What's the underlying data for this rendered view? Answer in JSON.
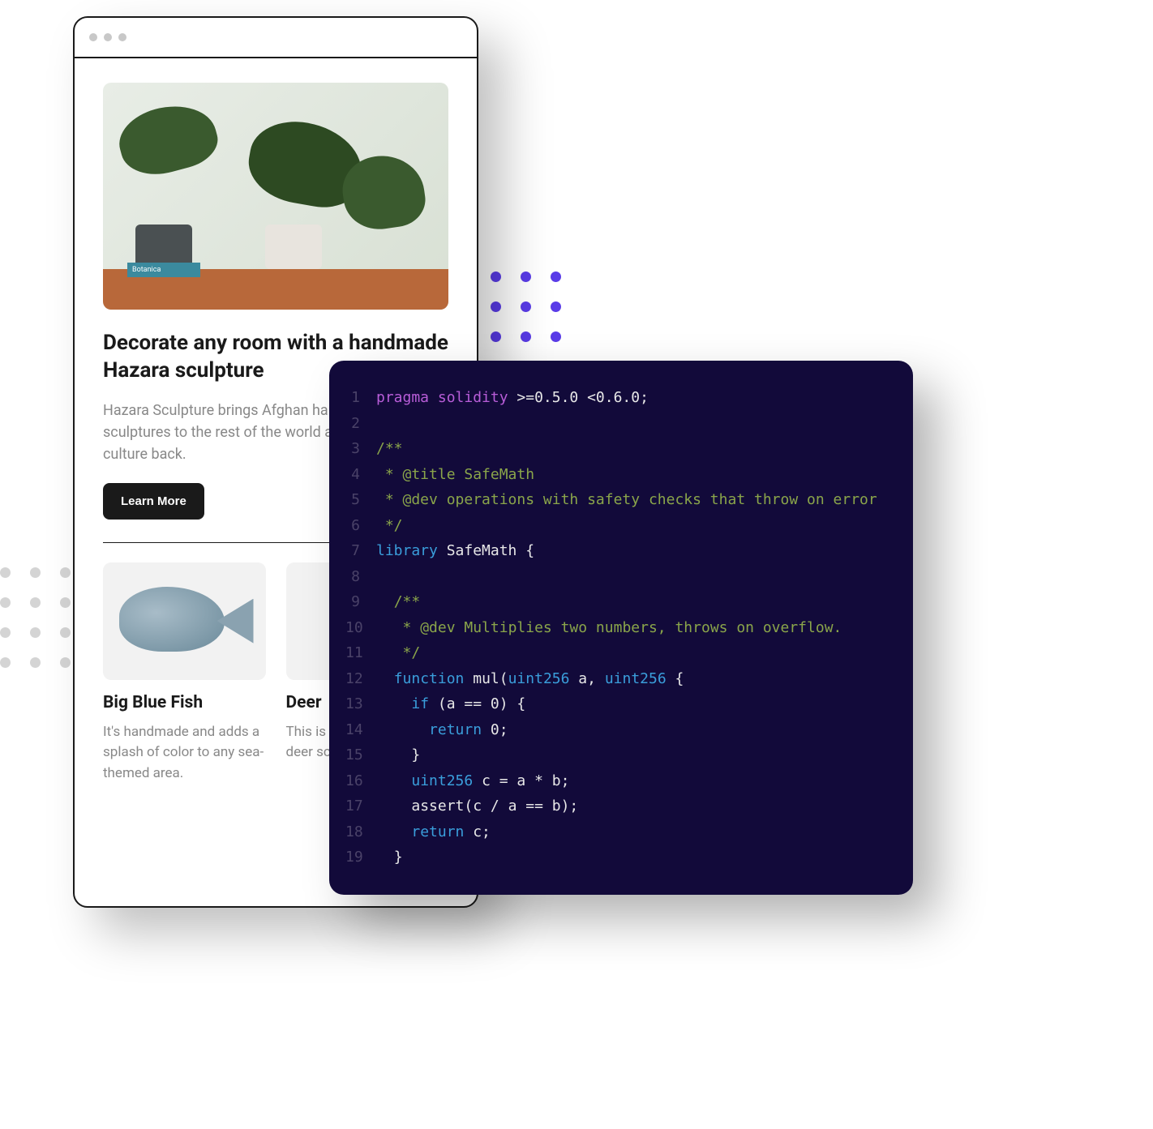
{
  "article": {
    "image_label": "Botanica",
    "title": "Decorate any room with a handmade Hazara sculpture",
    "description": "Hazara Sculpture brings Afghan handmade sculptures to the rest of the world and also keeps its culture back.",
    "button_label": "Learn More"
  },
  "products": [
    {
      "title": "Big Blue Fish",
      "description": "It's handmade and adds a splash of color to any sea-themed area."
    },
    {
      "title": "Deer",
      "description": "This is a handmade gold deer sculpture."
    }
  ],
  "code": {
    "lines": [
      {
        "n": 1,
        "segments": [
          {
            "t": "pragma solidity ",
            "c": "tok-kw"
          },
          {
            "t": ">=0.5.0 <0.6.0;",
            "c": "tok-ver"
          }
        ]
      },
      {
        "n": 2,
        "segments": []
      },
      {
        "n": 3,
        "segments": [
          {
            "t": "/**",
            "c": "tok-comment"
          }
        ]
      },
      {
        "n": 4,
        "segments": [
          {
            "t": " * @title SafeMath",
            "c": "tok-comment"
          }
        ]
      },
      {
        "n": 5,
        "segments": [
          {
            "t": " * @dev operations with safety checks that throw on error",
            "c": "tok-comment"
          }
        ]
      },
      {
        "n": 6,
        "segments": [
          {
            "t": " */",
            "c": "tok-comment"
          }
        ]
      },
      {
        "n": 7,
        "segments": [
          {
            "t": "library ",
            "c": "tok-lib"
          },
          {
            "t": "SafeMath {",
            "c": "tok-name"
          }
        ]
      },
      {
        "n": 8,
        "indent": 1,
        "segments": []
      },
      {
        "n": 9,
        "indent": 1,
        "segments": [
          {
            "t": "/**",
            "c": "tok-comment"
          }
        ]
      },
      {
        "n": 10,
        "indent": 1,
        "segments": [
          {
            "t": " * @dev Multiplies two numbers, throws on overflow.",
            "c": "tok-comment"
          }
        ]
      },
      {
        "n": 11,
        "indent": 1,
        "segments": [
          {
            "t": " */",
            "c": "tok-comment"
          }
        ]
      },
      {
        "n": 12,
        "indent": 1,
        "segments": [
          {
            "t": "function ",
            "c": "tok-fn"
          },
          {
            "t": "mul(",
            "c": "tok-name"
          },
          {
            "t": "uint256 ",
            "c": "tok-type"
          },
          {
            "t": "a, ",
            "c": "tok-name"
          },
          {
            "t": "uint256 ",
            "c": "tok-type"
          },
          {
            "t": "{",
            "c": "tok-name"
          }
        ]
      },
      {
        "n": 13,
        "indent": 2,
        "segments": [
          {
            "t": "if ",
            "c": "tok-fn"
          },
          {
            "t": "(a == 0) {",
            "c": "tok-name"
          }
        ]
      },
      {
        "n": 14,
        "indent": 2,
        "segments": [
          {
            "t": "  return ",
            "c": "tok-ret"
          },
          {
            "t": "0;",
            "c": "tok-name"
          }
        ]
      },
      {
        "n": 15,
        "indent": 2,
        "segments": [
          {
            "t": "}",
            "c": "tok-name"
          }
        ]
      },
      {
        "n": 16,
        "indent": 2,
        "segments": [
          {
            "t": "uint256 ",
            "c": "tok-type"
          },
          {
            "t": "c = a * b;",
            "c": "tok-name"
          }
        ]
      },
      {
        "n": 17,
        "indent": 2,
        "segments": [
          {
            "t": "assert(c / a == b);",
            "c": "tok-name"
          }
        ]
      },
      {
        "n": 18,
        "indent": 2,
        "segments": [
          {
            "t": "return ",
            "c": "tok-ret"
          },
          {
            "t": "c;",
            "c": "tok-name"
          }
        ]
      },
      {
        "n": 19,
        "indent": 1,
        "segments": [
          {
            "t": "}",
            "c": "tok-name"
          }
        ]
      }
    ]
  }
}
